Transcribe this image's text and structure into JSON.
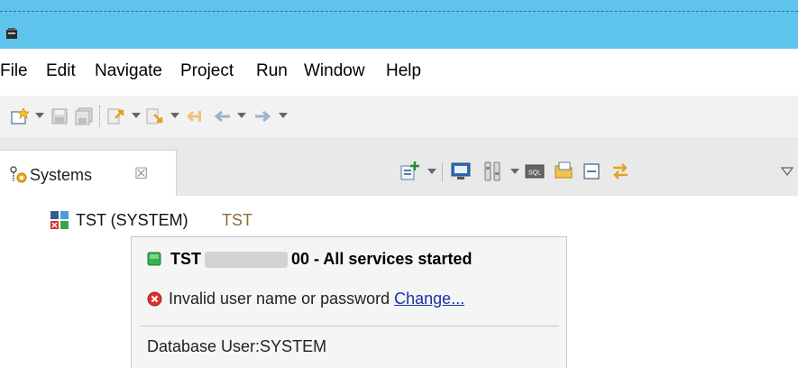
{
  "menubar": {
    "items": [
      "File",
      "Edit",
      "Navigate",
      "Project",
      "Run",
      "Window",
      "Help"
    ]
  },
  "toolbar": {
    "icons": [
      "new-icon",
      "save-icon",
      "save-all-icon",
      "next-annotation-icon",
      "previous-annotation-icon",
      "last-edit-icon",
      "back-icon",
      "forward-icon"
    ]
  },
  "view": {
    "tab_label": "Systems",
    "close_glyph": "☒",
    "toolbar_icons": [
      "add-system-icon",
      "console-icon",
      "tools-icon",
      "sql-icon",
      "open-folder-icon",
      "collapse-all-icon",
      "link-editor-icon",
      "view-menu-icon"
    ]
  },
  "tree": {
    "node_label": "TST (SYSTEM)",
    "node_suffix": "TST",
    "suffix_color": "#8a6d3b"
  },
  "tooltip": {
    "system_prefix": "TST",
    "system_suffix": "00 - All services started",
    "error_text": "Invalid user name or password",
    "change_link": "Change...",
    "db_user": "Database User:SYSTEM"
  },
  "colors": {
    "titlebar": "#5ec4ec",
    "status_ok": "#37b24d",
    "error": "#d9342b",
    "link": "#1a2fa8"
  }
}
